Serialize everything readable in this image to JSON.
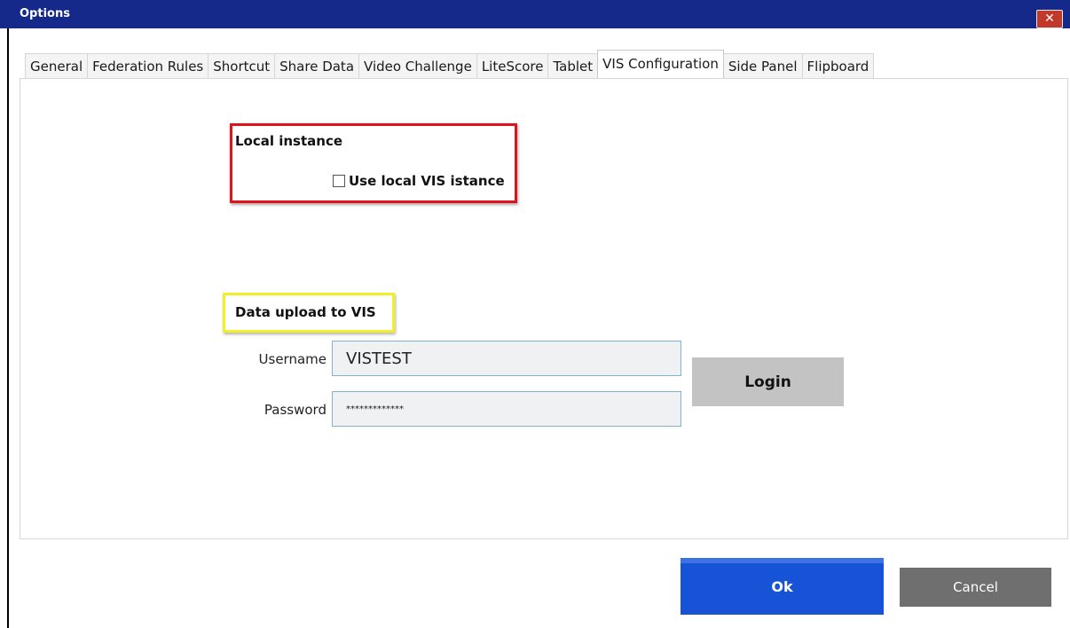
{
  "window": {
    "title": "Options",
    "close_glyph": "✕",
    "close_icon": "close-icon"
  },
  "tabs": [
    {
      "label": "General",
      "active": false
    },
    {
      "label": "Federation Rules",
      "active": false
    },
    {
      "label": "Shortcut",
      "active": false
    },
    {
      "label": "Share Data",
      "active": false
    },
    {
      "label": "Video Challenge",
      "active": false
    },
    {
      "label": "LiteScore",
      "active": false
    },
    {
      "label": "Tablet",
      "active": false
    },
    {
      "label": "VIS Configuration",
      "active": true
    },
    {
      "label": "Side Panel",
      "active": false
    },
    {
      "label": "Flipboard",
      "active": false
    }
  ],
  "local_instance": {
    "heading": "Local instance",
    "checkbox_label": "Use local VIS istance",
    "checked": false,
    "highlight_color": "#e1131a"
  },
  "data_upload": {
    "heading": "Data upload to VIS",
    "highlight_color": "#f2ee2a",
    "username_label": "Username",
    "username_value": "VISTEST",
    "password_label": "Password",
    "password_value": "*************",
    "login_label": "Login"
  },
  "footer": {
    "ok_label": "Ok",
    "cancel_label": "Cancel"
  },
  "colors": {
    "titlebar": "#14298a",
    "close_button": "#c0392b",
    "ok_button": "#1753d6",
    "cancel_button": "#6f6f6f",
    "login_button": "#c3c3c3",
    "input_background": "#eff1f3",
    "input_border": "#80b4cd"
  }
}
